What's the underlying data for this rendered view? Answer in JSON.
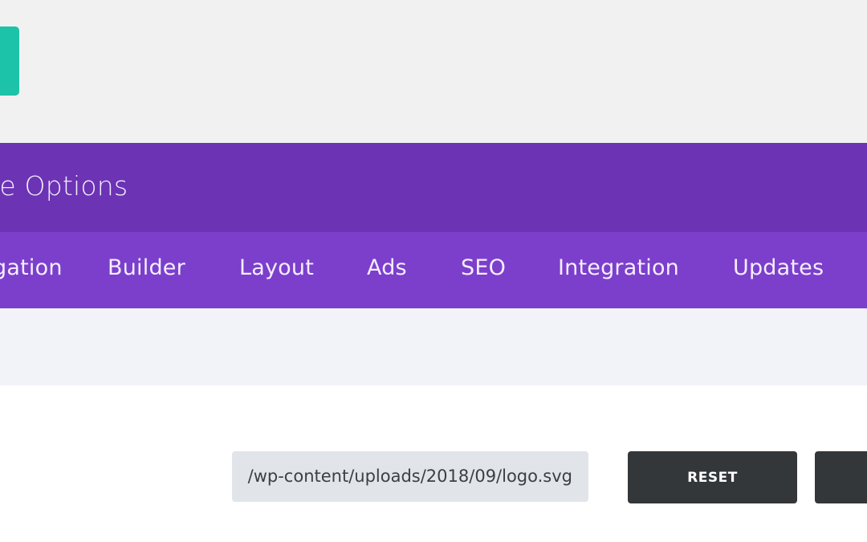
{
  "header": {
    "title": "Theme Options"
  },
  "tabs": [
    {
      "label": "Navigation"
    },
    {
      "label": "Builder"
    },
    {
      "label": "Layout"
    },
    {
      "label": "Ads"
    },
    {
      "label": "SEO"
    },
    {
      "label": "Integration"
    },
    {
      "label": "Updates"
    }
  ],
  "logo_field": {
    "value": "/wp-content/uploads/2018/09/logo.svg"
  },
  "buttons": {
    "reset_label": "RESET",
    "upload_label": ""
  },
  "colors": {
    "accent_teal": "#1dc3a8",
    "header_purple": "#6c33b5",
    "tab_purple": "#7c3fcc",
    "button_dark": "#33373a",
    "input_bg": "#e1e5e9"
  }
}
